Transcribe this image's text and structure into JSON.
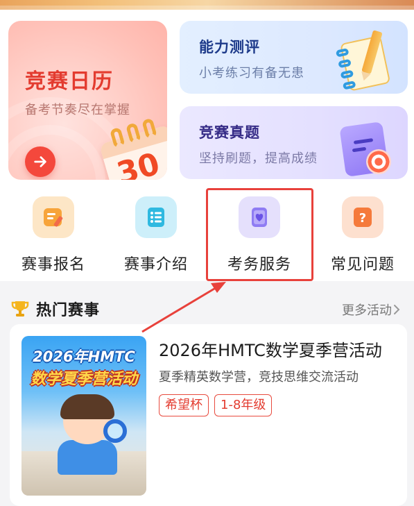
{
  "cards": {
    "calendar": {
      "title": "竞赛日历",
      "subtitle": "备考节奏尽在掌握",
      "day_number": "30"
    },
    "ability": {
      "title": "能力测评",
      "subtitle": "小考练习有备无患"
    },
    "exam": {
      "title": "竞赛真题",
      "subtitle": "坚持刷题，提高成绩"
    }
  },
  "quick_nav": [
    {
      "label": "赛事报名",
      "icon": "registration-icon",
      "color": "#f7a43a"
    },
    {
      "label": "赛事介绍",
      "icon": "list-icon",
      "color": "#2fb9e0"
    },
    {
      "label": "考务服务",
      "icon": "heart-notebook-icon",
      "color": "#8f7cf3"
    },
    {
      "label": "常见问题",
      "icon": "question-icon",
      "color": "#f57a3b"
    }
  ],
  "hot_events": {
    "title": "热门赛事",
    "more_label": "更多活动",
    "items": [
      {
        "title": "2026年HMTC数学夏季营活动",
        "description": "夏季精英数学营，竞技思维交流活动",
        "tags": [
          "希望杯",
          "1-8年级"
        ],
        "thumb_line1": "2026年HMTC",
        "thumb_line2": "数学夏季营活动"
      }
    ]
  },
  "colors": {
    "accent_red": "#e33b2f",
    "highlight_border": "#e8413b",
    "section_bg": "#f4f4f6"
  }
}
